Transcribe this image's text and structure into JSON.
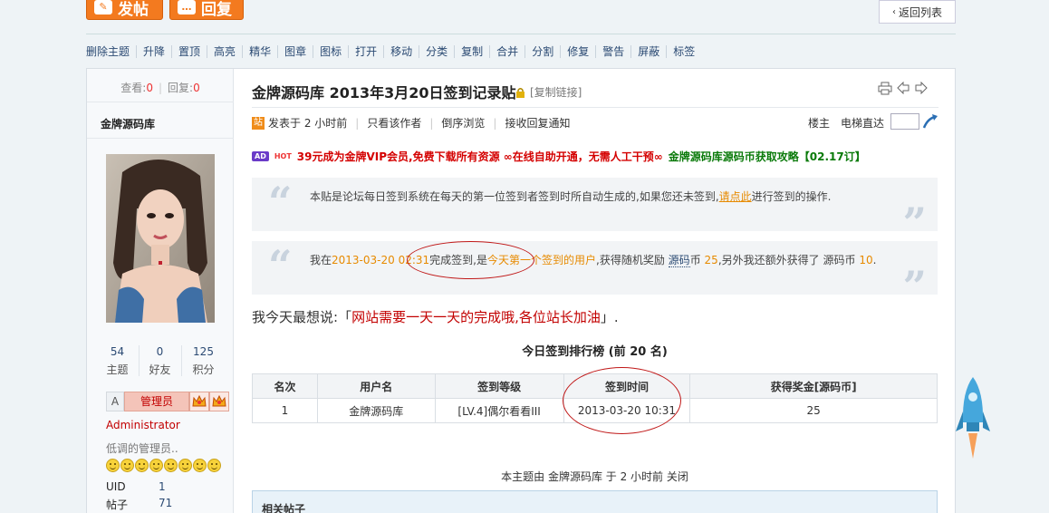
{
  "toolbar": {
    "post_label": "发帖",
    "reply_label": "回复",
    "back_label": "返回列表"
  },
  "mod_actions": [
    "删除主题",
    "升降",
    "置顶",
    "高亮",
    "精华",
    "图章",
    "图标",
    "打开",
    "移动",
    "分类",
    "复制",
    "合并",
    "分割",
    "修复",
    "警告",
    "屏蔽",
    "标签"
  ],
  "stats": {
    "views_label": "查看:",
    "views": "0",
    "replies_label": "回复:",
    "replies": "0"
  },
  "author": {
    "name": "金牌源码库",
    "counts": [
      {
        "value": "54",
        "label": "主题"
      },
      {
        "value": "0",
        "label": "好友"
      },
      {
        "value": "125",
        "label": "积分"
      }
    ],
    "rank_letter": "A",
    "rank_label": "管理员",
    "title": "Administrator",
    "signature": "低调的管理员..",
    "uid_label": "UID",
    "uid": "1",
    "posts_label": "帖子",
    "posts": "71"
  },
  "post": {
    "title": "金牌源码库 2013年3月20日签到记录贴",
    "copy_link": "[复制链接]",
    "badge": "站",
    "posted": "发表于 2 小时前",
    "only_author": "只看该作者",
    "reverse": "倒序浏览",
    "notify": "接收回复通知",
    "floor_owner": "楼主",
    "elevator": "电梯直达",
    "ad": {
      "tag": "AD",
      "hot": "HOT",
      "text1": "39元成为金牌VIP会员,免费下载所有资源 ∞在线自助开通，无需人工干预∞",
      "text2": "金牌源码库源码币获取攻略【02.17订】"
    },
    "quote1": {
      "before": "本贴是论坛每日签到系统在每天的第一位签到者签到时所自动生成的,如果您还未签到,",
      "link": "请点此",
      "after": "进行签到的操作."
    },
    "quote2": {
      "p1": "我在",
      "time": "2013-03-20 02:31",
      "p2": "完成签到,是",
      "today": "今天",
      "p3": "第一个签到的用户",
      "p4": ",获得随机奖励",
      "coin": "源码",
      "p5": "币",
      "num1": "25",
      "p6": ",另外我还额外获得了",
      "coin2": "源码",
      "p7": "币",
      "num2": "10",
      "p8": "."
    },
    "mood_prefix": "我今天最想说:「",
    "mood": "网站需要一天一天的完成哦,各位站长加油",
    "mood_suffix": "」.",
    "rank_title": "今日签到排行榜 (前 20 名)",
    "table_headers": [
      "名次",
      "用户名",
      "签到等级",
      "签到时间",
      "获得奖金[源码币]"
    ],
    "table_rows": [
      [
        "1",
        "金牌源码库",
        "[LV.4]偶尔看看III",
        "2013-03-20 10:31",
        "25"
      ]
    ],
    "closed_note": "本主题由 金牌源码库 于 2 小时前 关闭",
    "related": "相关帖子"
  },
  "colors": {
    "accent_orange": "#f37a1f",
    "link_blue": "#2b4a73",
    "highlight_red": "#c20000",
    "annotation_red": "#c01818"
  }
}
